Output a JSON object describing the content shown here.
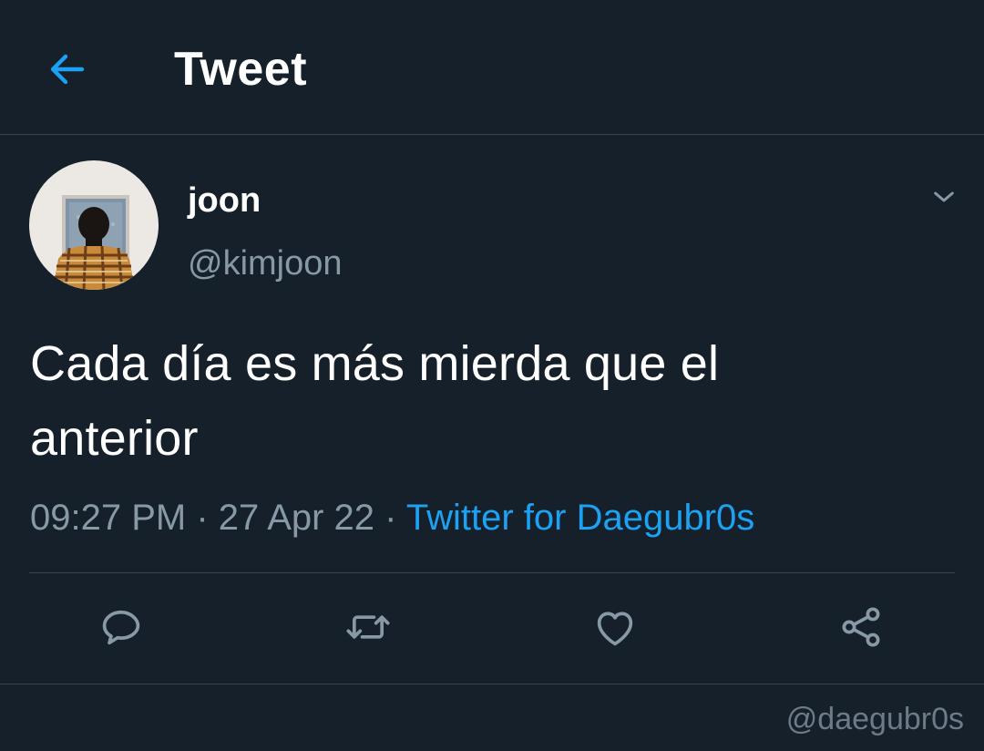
{
  "header": {
    "title": "Tweet",
    "back_icon": "arrow-left-icon"
  },
  "author": {
    "display_name": "joon",
    "handle": "@kimjoon",
    "avatar": "profile-photo"
  },
  "tweet": {
    "text_line1": "Cada día es más mierda que el",
    "text_line2": "anterior",
    "time": "09:27 PM",
    "date": "27 Apr 22",
    "separator": "·",
    "source": "Twitter for Daegubr0s"
  },
  "actions": [
    {
      "icon": "reply-icon"
    },
    {
      "icon": "retweet-icon"
    },
    {
      "icon": "like-icon"
    },
    {
      "icon": "share-icon"
    }
  ],
  "watermark": "@daegubr0s",
  "colors": {
    "background": "#15202b",
    "accent": "#1da1f2",
    "secondary_text": "#8899a6",
    "border": "#38444d"
  }
}
